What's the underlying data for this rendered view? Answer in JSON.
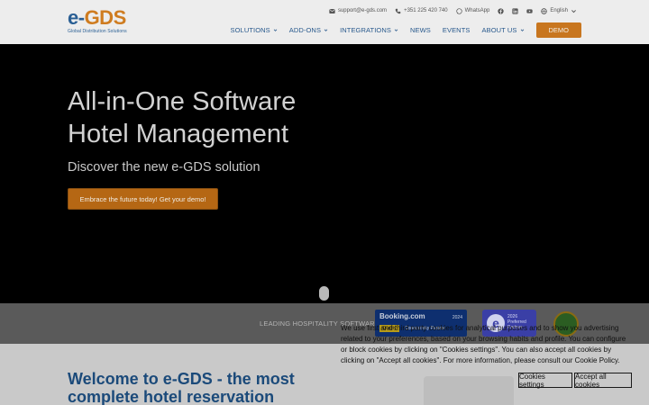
{
  "logo": {
    "main_e": "e-",
    "main_gds": "GDS",
    "subtitle": "Global Distribution Solutions"
  },
  "topbar": {
    "email": "support@e-gds.com",
    "phone": "+351 225 420 740",
    "whatsapp": "WhatsApp",
    "social": [
      "facebook-icon",
      "linkedin-icon",
      "youtube-icon"
    ],
    "language": "English"
  },
  "nav": {
    "items": [
      {
        "label": "SOLUTIONS",
        "has_dropdown": true
      },
      {
        "label": "ADD-ONS",
        "has_dropdown": true
      },
      {
        "label": "INTEGRATIONS",
        "has_dropdown": true
      },
      {
        "label": "NEWS",
        "has_dropdown": false
      },
      {
        "label": "EVENTS",
        "has_dropdown": false
      },
      {
        "label": "ABOUT US",
        "has_dropdown": true
      }
    ],
    "demo_label": "DEMO"
  },
  "hero": {
    "title_line1": "All-in-One Software",
    "title_line2": "Hotel Management",
    "subtitle": "Discover the new e-GDS solution",
    "cta_label": "Embrace the future today! Get your demo!"
  },
  "partners": {
    "label": "LEADING HOSPITALITY SOFTWARE",
    "booking": {
      "title": "Booking.com",
      "year": "2024",
      "tag": "Quality",
      "tag2": "Connectivity Partner"
    },
    "preferred": {
      "letter": "e",
      "line1": "2026",
      "line2": "Preferred",
      "line3": "Partner"
    }
  },
  "welcome": {
    "title": "Welcome to e-GDS - the most complete hotel reservation"
  },
  "cookie": {
    "text": "We use first and third party cookies for analytical purposes and to show you advertising related to your preferences, based on your browsing habits and profile. You can configure or block cookies by clicking on \"Cookies settings\". You can also accept all cookies by clicking on \"Accept all cookies\". For more information, please consult our Cookie Policy.",
    "settings_label": "Cookies settings",
    "accept_label": "Accept all cookies"
  },
  "colors": {
    "brand_blue": "#27588c",
    "brand_orange": "#c8761f",
    "hero_bg": "#000000"
  }
}
